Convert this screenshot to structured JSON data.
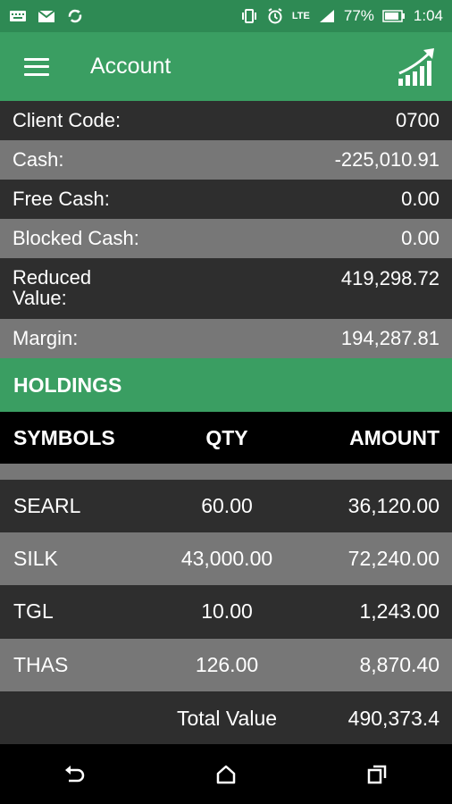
{
  "status_bar": {
    "battery_percent": "77%",
    "time": "1:04",
    "network": "LTE",
    "icons": [
      "keyboard-icon",
      "gmail-icon",
      "sync-icon",
      "vibrate-icon",
      "alarm-icon",
      "lte-icon",
      "signal-icon",
      "battery-icon"
    ]
  },
  "app_bar": {
    "title": "Account",
    "menu_icon": "hamburger-menu-icon",
    "action_icon": "growth-chart-icon"
  },
  "account": [
    {
      "label": "Client Code:",
      "value": "0700"
    },
    {
      "label": "Cash:",
      "value": "-225,010.91"
    },
    {
      "label": "Free Cash:",
      "value": "0.00"
    },
    {
      "label": "Blocked Cash:",
      "value": "0.00"
    },
    {
      "label": "Reduced\nValue:",
      "value": "419,298.72"
    },
    {
      "label": "Margin:",
      "value": "194,287.81"
    }
  ],
  "holdings": {
    "title": "HOLDINGS",
    "columns": {
      "symbol": "SYMBOLS",
      "qty": "QTY",
      "amount": "AMOUNT"
    },
    "rows": [
      {
        "symbol": "SEARL",
        "qty": "60.00",
        "amount": "36,120.00"
      },
      {
        "symbol": "SILK",
        "qty": "43,000.00",
        "amount": "72,240.00"
      },
      {
        "symbol": "TGL",
        "qty": "10.00",
        "amount": "1,243.00"
      },
      {
        "symbol": "THAS",
        "qty": "126.00",
        "amount": "8,870.40"
      }
    ],
    "total_label": "Total Value",
    "total_value": "490,373.4"
  },
  "nav_bar": {
    "icons": [
      "back-icon",
      "home-icon",
      "recents-icon"
    ]
  }
}
